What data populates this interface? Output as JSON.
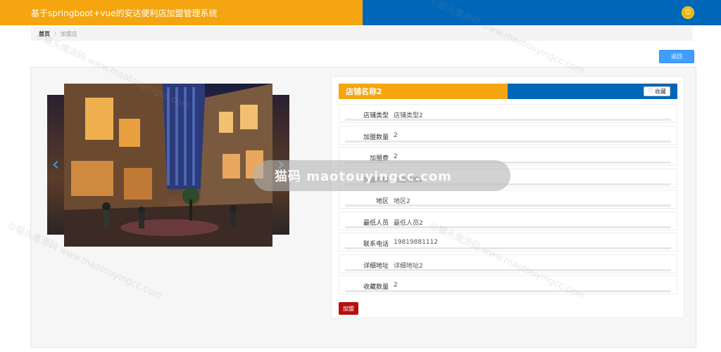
{
  "header": {
    "title": "基于springboot+vue的安达便利店加盟管理系统",
    "avatar_text": "☺"
  },
  "breadcrumb": {
    "home": "首页",
    "separator": "/",
    "current": "加盟店"
  },
  "back_button": "返回",
  "carousel": {
    "prev_icon": "‹",
    "next_icon": "›"
  },
  "shop": {
    "name": "店铺名称2",
    "favorite_icon": "♡",
    "favorite_label": "收藏",
    "fields": [
      {
        "label": "店铺类型",
        "value": "店铺类型2"
      },
      {
        "label": "加盟数量",
        "value": "2"
      },
      {
        "label": "加盟费",
        "value": "2"
      },
      {
        "label": "加盟规模",
        "value": "加盟规模2"
      },
      {
        "label": "地区",
        "value": "地区2"
      },
      {
        "label": "最低人员",
        "value": "最低人员2"
      },
      {
        "label": "联系电话",
        "value": "19819881112"
      },
      {
        "label": "详细地址",
        "value": "详细地址2"
      },
      {
        "label": "收藏数量",
        "value": "2"
      }
    ],
    "join_button": "加盟"
  },
  "watermark": {
    "text": "©猫头鹰源码 www.maotouyingcc.com",
    "banner": "猫码 maotouyingcc.com"
  },
  "colors": {
    "orange": "#f5a50f",
    "blue": "#0066b8",
    "back_button": "#409eff",
    "join_button": "#b50f0f"
  }
}
